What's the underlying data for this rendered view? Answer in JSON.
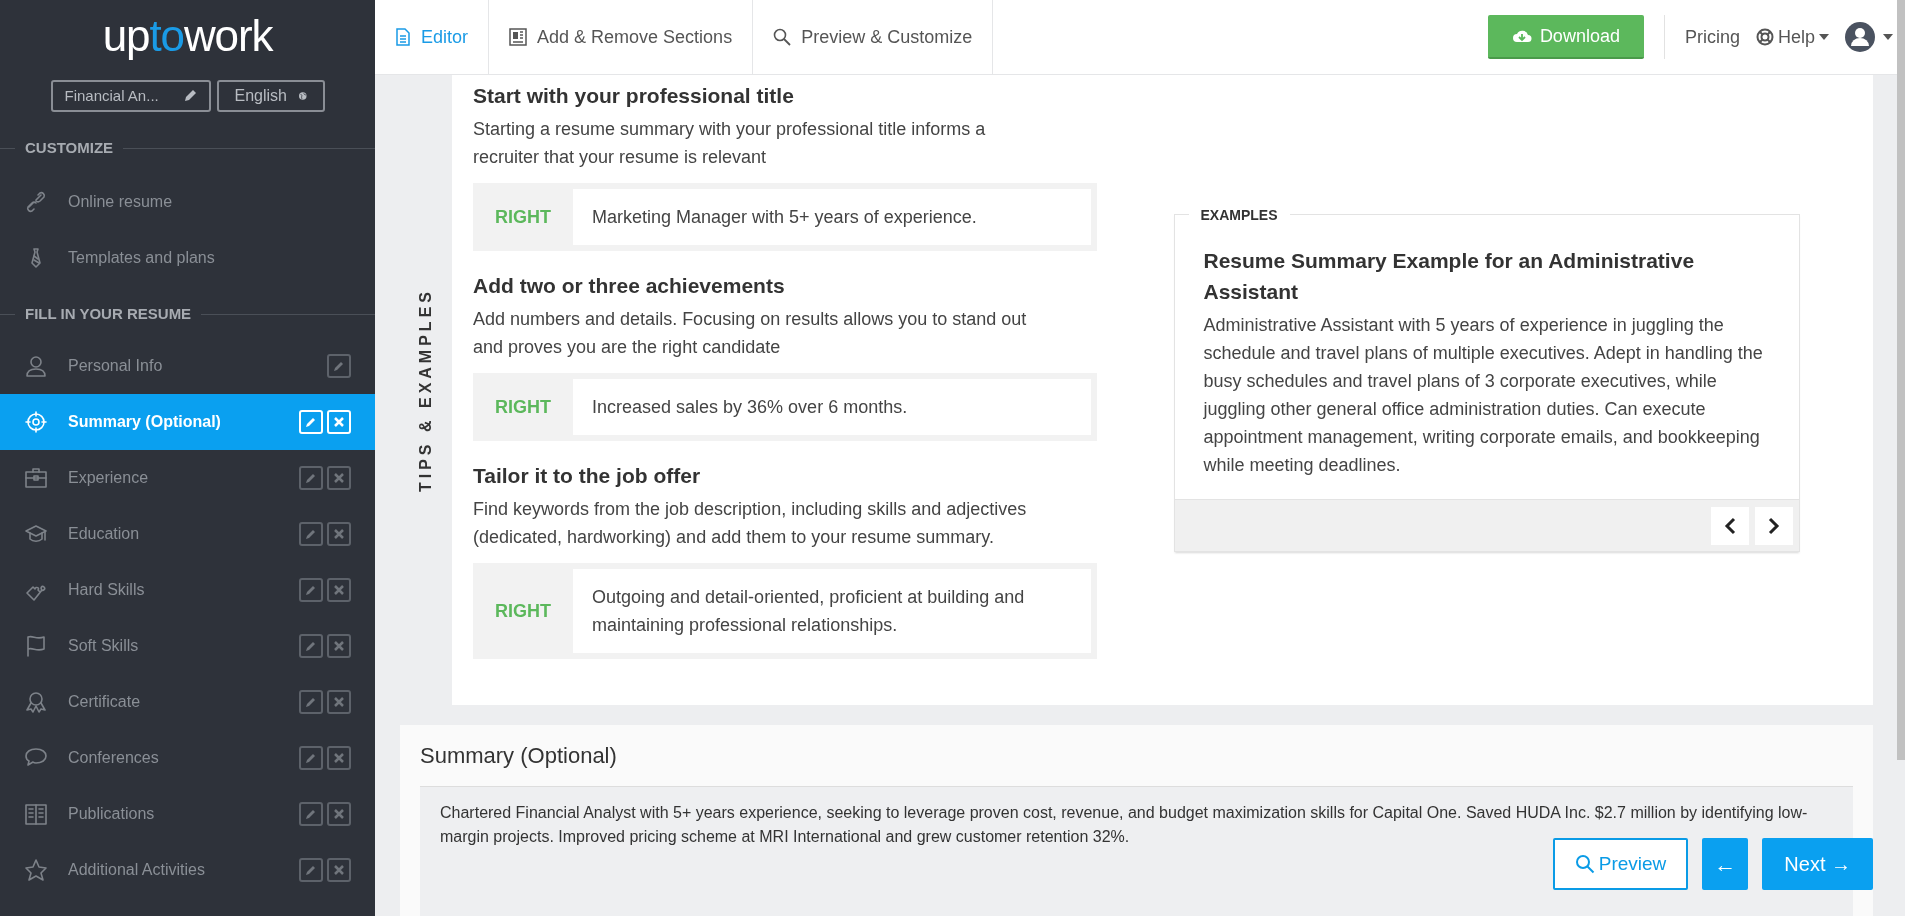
{
  "sidebar": {
    "logo": [
      "up",
      "to",
      "work"
    ],
    "resume_title": "Financial An...",
    "language": "English",
    "sections": [
      {
        "heading": "CUSTOMIZE",
        "items": [
          {
            "label": "Online resume",
            "selected": false,
            "editable": false,
            "deletable": false
          },
          {
            "label": "Templates and plans",
            "selected": false,
            "editable": false,
            "deletable": false
          }
        ]
      },
      {
        "heading": "FILL IN YOUR RESUME",
        "items": [
          {
            "label": "Personal Info",
            "selected": false,
            "editable": true,
            "deletable": false
          },
          {
            "label": "Summary (Optional)",
            "selected": true,
            "editable": true,
            "deletable": true
          },
          {
            "label": "Experience",
            "selected": false,
            "editable": true,
            "deletable": true
          },
          {
            "label": "Education",
            "selected": false,
            "editable": true,
            "deletable": true
          },
          {
            "label": "Hard Skills",
            "selected": false,
            "editable": true,
            "deletable": true
          },
          {
            "label": "Soft Skills",
            "selected": false,
            "editable": true,
            "deletable": true
          },
          {
            "label": "Certificate",
            "selected": false,
            "editable": true,
            "deletable": true
          },
          {
            "label": "Conferences",
            "selected": false,
            "editable": true,
            "deletable": true
          },
          {
            "label": "Publications",
            "selected": false,
            "editable": true,
            "deletable": true
          },
          {
            "label": "Additional Activities",
            "selected": false,
            "editable": true,
            "deletable": true
          }
        ]
      }
    ]
  },
  "tabs": [
    {
      "label": "Editor",
      "selected": true
    },
    {
      "label": "Add & Remove Sections",
      "selected": false
    },
    {
      "label": "Preview & Customize",
      "selected": false
    }
  ],
  "toolbar": {
    "download": "Download",
    "pricing": "Pricing",
    "help": "Help"
  },
  "tips": {
    "label": "TIPS & EXAMPLES",
    "items": [
      {
        "title": "Start with your professional title",
        "text": "Starting a resume summary with your professional title informs a recruiter that your resume is relevant",
        "verdict": "RIGHT",
        "example": "Marketing Manager with 5+ years of experience."
      },
      {
        "title": "Add two or three achievements",
        "text": "Add numbers and details. Focusing on results allows you to stand out and proves you are the right candidate",
        "verdict": "RIGHT",
        "example": "Increased sales by 36% over 6 months."
      },
      {
        "title": "Tailor it to the job offer",
        "text": "Find keywords from the job description, including skills and adjectives (dedicated, hardworking) and add them to your resume summary.",
        "verdict": "RIGHT",
        "example": "Outgoing and detail-oriented, proficient at building and maintaining professional relationships."
      }
    ]
  },
  "examples": {
    "label": "EXAMPLES",
    "title": "Resume Summary Example for an Administrative Assistant",
    "text": "Administrative Assistant with 5 years of experience in juggling the schedule and travel plans of multiple executives. Adept in handling the busy schedules and travel plans of 3 corporate executives, while juggling other general office administration duties. Can execute appointment management, writing corporate emails, and bookkeeping while meeting deadlines."
  },
  "summary": {
    "title": "Summary (Optional)",
    "value": "Chartered Financial Analyst with 5+ years experience, seeking to leverage proven cost, revenue, and budget maximization skills for Capital One. Saved HUDA Inc. $2.7 million by identifying low-margin projects. Improved pricing scheme at MRI International and grew customer retention 32%.",
    "preview": "Preview",
    "back": "←",
    "next": "Next →"
  }
}
